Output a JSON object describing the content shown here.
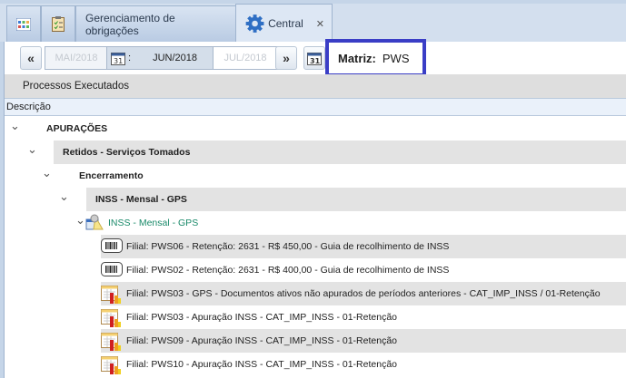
{
  "tabs": [
    {
      "icon": "grid-icon",
      "label": ""
    },
    {
      "icon": "checklist-icon",
      "label": ""
    },
    {
      "icon": "",
      "label": "Gerenciamento de obrigações"
    },
    {
      "icon": "gear-icon",
      "label": "Central",
      "closable": true,
      "active": true
    }
  ],
  "close_glyph": "✕",
  "period": {
    "prev": "MAI/2018",
    "current": "JUN/2018",
    "next": "JUL/2018",
    "prev_btn": "«",
    "next_btn": "»",
    "sep": ":"
  },
  "matriz": {
    "label": "Matriz:",
    "value": "PWS",
    "highlight_color": "#3a3ec6"
  },
  "section_title": "Processos Executados",
  "column_header": "Descrição",
  "tree": [
    {
      "level": 0,
      "label": "APURAÇÕES",
      "bold": true,
      "expanded": true
    },
    {
      "level": 1,
      "label": "Retidos - Serviços Tomados",
      "bold": true,
      "expanded": true,
      "gray": true
    },
    {
      "level": 2,
      "label": "Encerramento",
      "bold": true,
      "expanded": true
    },
    {
      "level": 3,
      "label": "INSS - Mensal - GPS",
      "bold": true,
      "expanded": true,
      "gray": true
    },
    {
      "level": 4,
      "label": "INSS - Mensal - GPS",
      "icon": "process-icon",
      "expanded": true,
      "color": "#1a8a6a"
    },
    {
      "level": 5,
      "label": "Filial: PWS06 - Retenção: 2631 - R$ 450,00 - Guia de recolhimento de INSS",
      "icon": "barcode-icon",
      "gray": true
    },
    {
      "level": 5,
      "label": "Filial: PWS02 - Retenção: 2631 - R$ 400,00 - Guia de recolhimento de INSS",
      "icon": "barcode-icon"
    },
    {
      "level": 5,
      "label": "Filial: PWS03 - GPS - Documentos ativos não apurados de períodos anteriores - CAT_IMP_INSS / 01-Retenção",
      "icon": "report-chart-icon",
      "gray": true
    },
    {
      "level": 5,
      "label": "Filial: PWS03 - Apuração INSS - CAT_IMP_INSS - 01-Retenção",
      "icon": "report-chart-icon"
    },
    {
      "level": 5,
      "label": "Filial: PWS09 - Apuração INSS - CAT_IMP_INSS - 01-Retenção",
      "icon": "report-chart-icon",
      "gray": true
    },
    {
      "level": 5,
      "label": "Filial: PWS10  - Apuração INSS - CAT_IMP_INSS - 01-Retenção",
      "icon": "report-chart-icon"
    }
  ]
}
